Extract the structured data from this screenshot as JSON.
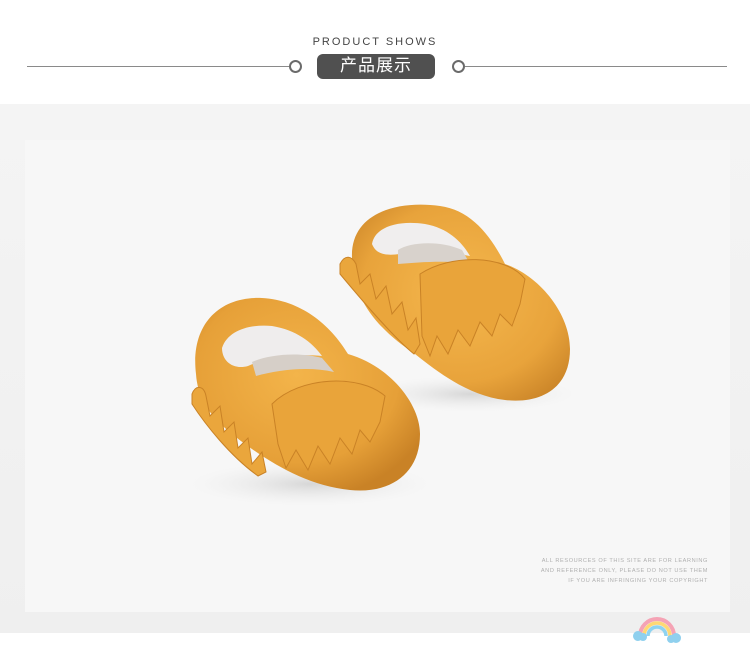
{
  "header": {
    "subtitle": "PRODUCT SHOWS",
    "title": "产品展示"
  },
  "product_photo": {
    "subject": "baby-moccasin-shoes",
    "colors": {
      "leather": "#e9a43a",
      "background": "#f4f4f4"
    }
  },
  "watermark": {
    "icon": "rainbow-icon",
    "disclaimer_lines": [
      "ALL RESOURCES OF THIS SITE ARE FOR LEARNING",
      "AND REFERENCE ONLY, PLEASE DO NOT USE THEM",
      "IF YOU ARE INFRINGING YOUR COPYRIGHT"
    ]
  }
}
